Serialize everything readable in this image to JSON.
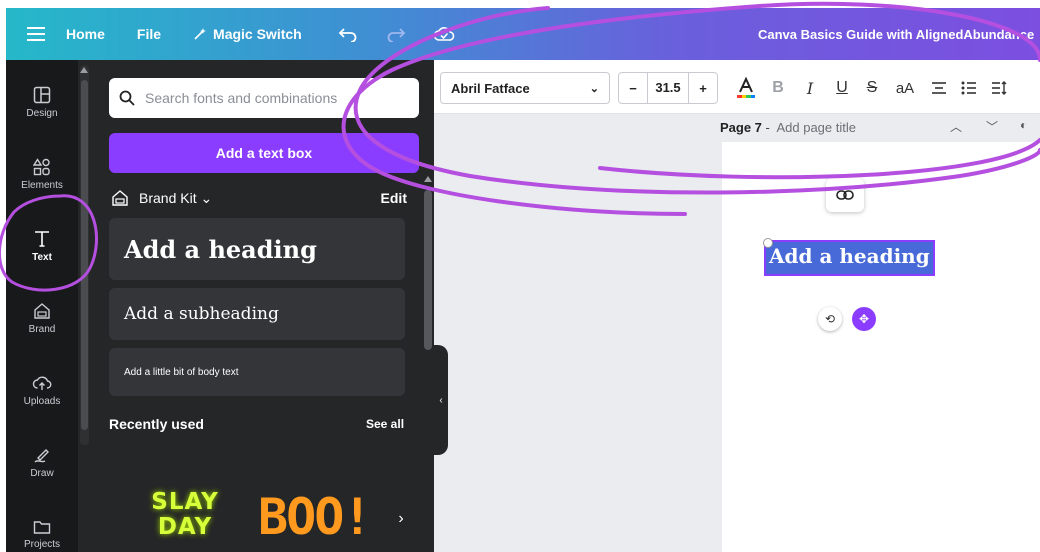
{
  "topbar": {
    "home": "Home",
    "file": "File",
    "magic_switch": "Magic Switch",
    "doc_title": "Canva Basics Guide with AlignedAbundance"
  },
  "rail": {
    "items": [
      {
        "label": "Design",
        "icon": "layout-icon"
      },
      {
        "label": "Elements",
        "icon": "shapes-icon"
      },
      {
        "label": "Text",
        "icon": "text-icon"
      },
      {
        "label": "Brand",
        "icon": "brand-icon"
      },
      {
        "label": "Uploads",
        "icon": "cloud-upload-icon"
      },
      {
        "label": "Draw",
        "icon": "pen-icon"
      },
      {
        "label": "Projects",
        "icon": "folder-icon"
      }
    ],
    "active": "Text"
  },
  "panel": {
    "search_placeholder": "Search fonts and combinations",
    "add_textbox": "Add a text box",
    "brand_kit": "Brand Kit",
    "edit": "Edit",
    "heading": "Add a heading",
    "subheading": "Add a subheading",
    "body": "Add a little bit of body text",
    "recently_used": "Recently used",
    "see_all": "See all",
    "recent": [
      {
        "line1": "SLAY",
        "line2": "DAY"
      },
      {
        "text": "BOO!"
      }
    ]
  },
  "toolbar": {
    "font": "Abril Fatface",
    "font_size": "31.5",
    "minus": "−",
    "plus": "+",
    "case": "aA"
  },
  "page": {
    "number": "Page 7",
    "separator": " - ",
    "title_placeholder": "Add page title",
    "heading_text": "Add a heading"
  },
  "colors": {
    "accent": "#8b3dff",
    "selection": "#4869d8",
    "annotation": "#b44fe0"
  }
}
